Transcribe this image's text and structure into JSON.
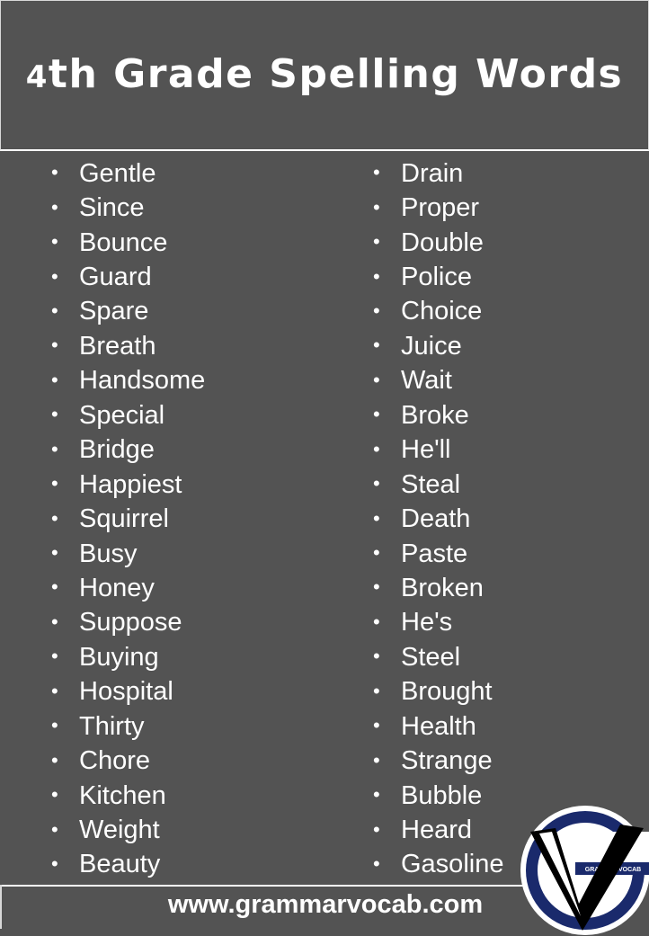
{
  "header": {
    "title_number": "4",
    "title_rest": "th Grade Spelling Words"
  },
  "words": {
    "left": [
      "Gentle",
      "Since",
      "Bounce",
      "Guard",
      "Spare",
      "Breath",
      "Handsome",
      "Special",
      "Bridge",
      "Happiest",
      "Squirrel",
      "Busy",
      "Honey",
      "Suppose",
      "Buying",
      "Hospital",
      "Thirty",
      "Chore",
      "Kitchen",
      "Weight",
      "Beauty"
    ],
    "right": [
      "Drain",
      "Proper",
      "Double",
      "Police",
      "Choice",
      "Juice",
      "Wait",
      "Broke",
      "He'll",
      "Steal",
      "Death",
      "Paste",
      "Broken",
      "He's",
      "Steel",
      "Brought",
      "Health",
      "Strange",
      "Bubble",
      "Heard",
      "Gasoline"
    ]
  },
  "bullet": "•",
  "footer": {
    "url": "www.grammarvocab.com"
  },
  "logo": {
    "text": "GRAMMARVOCAB",
    "colors": {
      "ring": "#1a2a6c",
      "v": "#000000",
      "outer": "#ffffff"
    }
  },
  "colors": {
    "background": "#535353",
    "text": "#ffffff"
  }
}
